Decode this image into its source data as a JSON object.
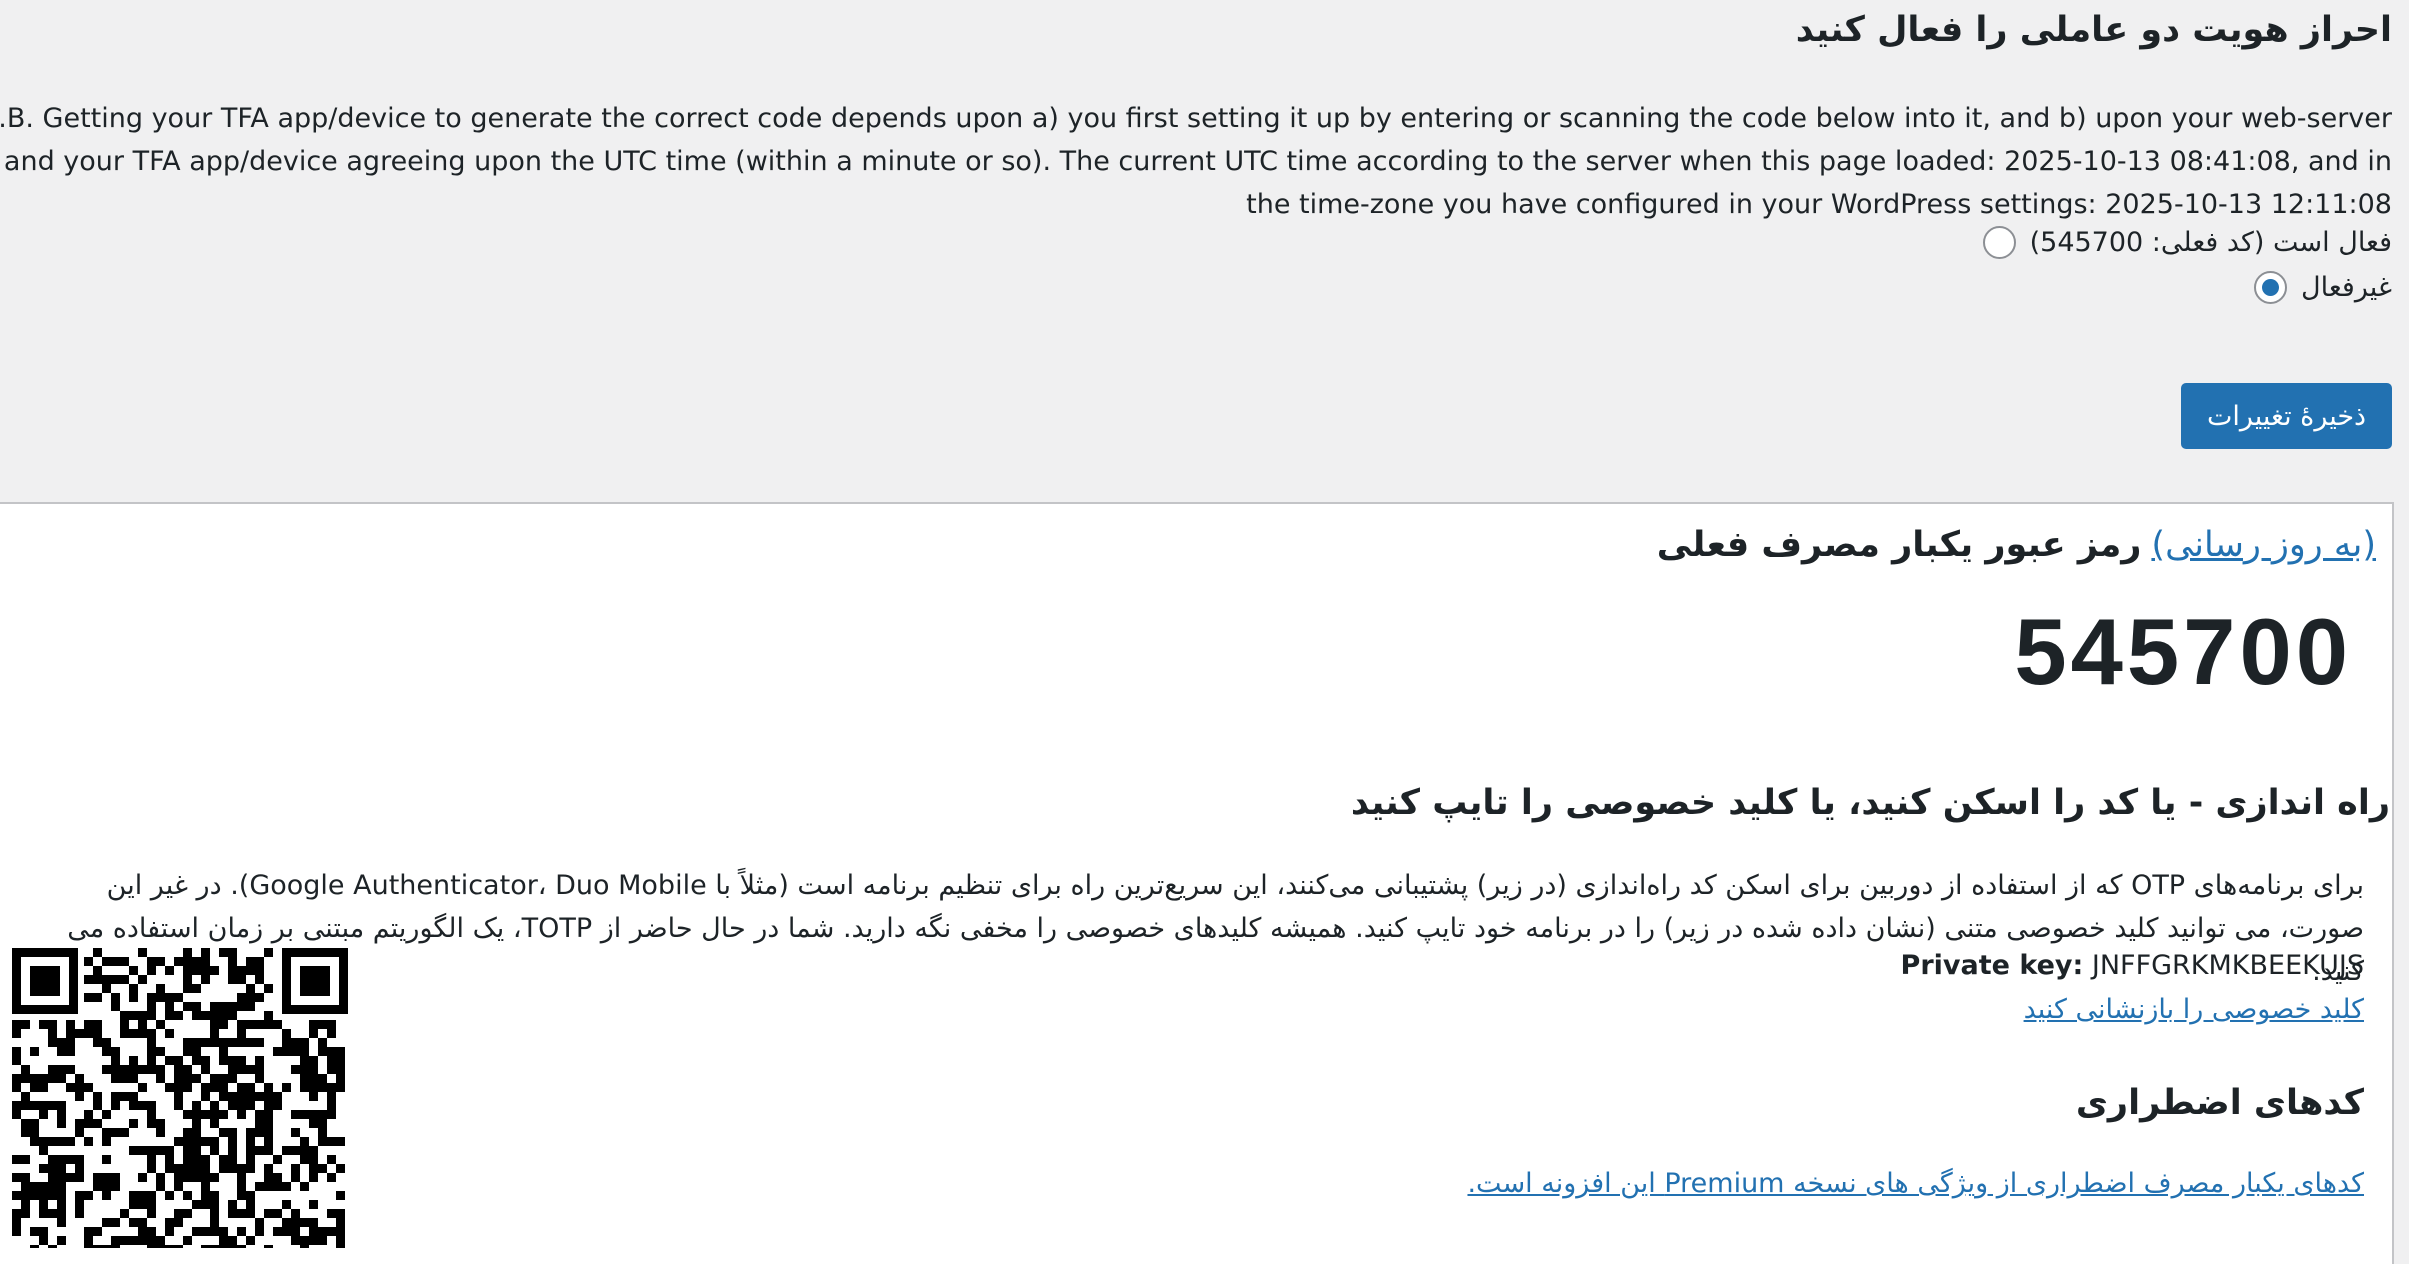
{
  "tfa": {
    "title": "احراز هویت دو عاملی را فعال کنید",
    "utc_note": "N.B. Getting your TFA app/device to generate the correct code depends upon a) you first setting it up by entering or scanning the code below into it, and b) upon your web-server and your TFA app/device agreeing upon the UTC time (within a minute or so). The current UTC time according to the server when this page loaded: 2025-10-13 08:41:08, and in the time-zone you have configured in your WordPress settings: 2025-10-13 12:11:08",
    "options": [
      {
        "label": "فعال است (کد فعلی: 545700)",
        "checked": false
      },
      {
        "label": "غیرفعال",
        "checked": true
      }
    ],
    "save_label": "ذخیرهٔ تغییرات"
  },
  "otp": {
    "heading": "رمز عبور یکبار مصرف فعلی",
    "refresh_link": "(به روز رسانی)",
    "code": "545700"
  },
  "setup": {
    "heading": "راه اندازی - یا کد را اسکن کنید، یا کلید خصوصی را تایپ کنید",
    "description": "برای برنامه‌های OTP که از استفاده از دوربین برای اسکن کد راه‌اندازی (در زیر) پشتیبانی می‌کنند، این سریع‌ترین راه برای تنظیم برنامه است (مثلاً با Google Authenticator، Duo Mobile). در غیر این صورت، می توانید کلید خصوصی متنی (نشان داده شده در زیر) را در برنامه خود تایپ کنید. همیشه کلیدهای خصوصی را مخفی نگه دارید. شما در حال حاضر از TOTP، یک الگوریتم مبتنی بر زمان استفاده می کنید.",
    "private_key_label": "Private key:",
    "private_key_value": "JNFFGRKMKBEEKUJS",
    "reset_link": "کلید خصوصی را بازنشانی کنید"
  },
  "emergency": {
    "heading": "کدهای اضطراری",
    "premium_link": "کدهای یکبار مصرف اضطراری از ویژگی های نسخه Premium این افزونه است."
  },
  "colors": {
    "accent": "#2271b1",
    "background": "#f0f0f1",
    "panel": "#ffffff",
    "text": "#1d2327"
  },
  "icons": {
    "qr": "qr-code-icon"
  }
}
